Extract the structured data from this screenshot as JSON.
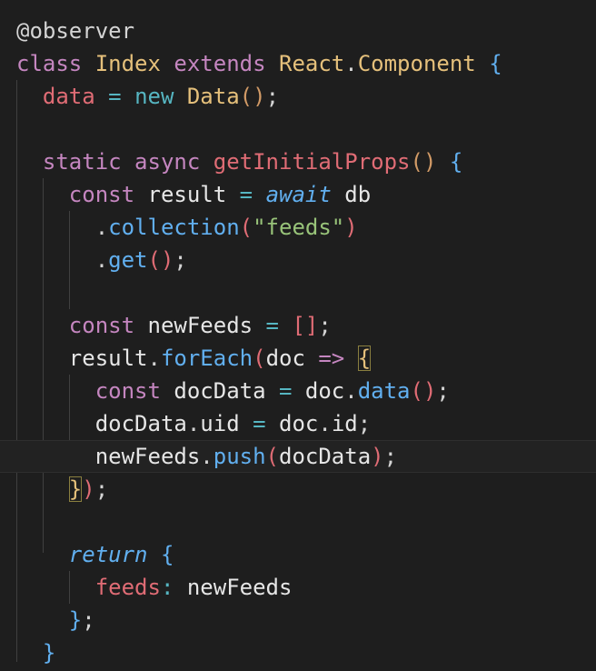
{
  "editor": {
    "lines": [
      {
        "tokens": [
          {
            "t": "@observer",
            "c": "tok-decorator"
          }
        ]
      },
      {
        "tokens": [
          {
            "t": "class ",
            "c": "tok-keyword"
          },
          {
            "t": "Index ",
            "c": "tok-class"
          },
          {
            "t": "extends ",
            "c": "tok-inherit"
          },
          {
            "t": "React",
            "c": "tok-class"
          },
          {
            "t": ".",
            "c": "tok-punct"
          },
          {
            "t": "Component ",
            "c": "tok-class"
          },
          {
            "t": "{",
            "c": "tok-brace"
          }
        ]
      },
      {
        "tokens": [
          {
            "t": "  data ",
            "c": "tok-prop"
          },
          {
            "t": "= ",
            "c": "tok-op"
          },
          {
            "t": "new ",
            "c": "tok-new"
          },
          {
            "t": "Data",
            "c": "tok-class"
          },
          {
            "t": "()",
            "c": "tok-paren"
          },
          {
            "t": ";",
            "c": "tok-punct"
          }
        ]
      },
      {
        "tokens": []
      },
      {
        "tokens": [
          {
            "t": "  static ",
            "c": "tok-keyword"
          },
          {
            "t": "async ",
            "c": "tok-keyword"
          },
          {
            "t": "getInitialProps",
            "c": "tok-prop"
          },
          {
            "t": "() ",
            "c": "tok-paren"
          },
          {
            "t": "{",
            "c": "tok-brace"
          }
        ]
      },
      {
        "tokens": [
          {
            "t": "    const ",
            "c": "tok-const"
          },
          {
            "t": "result ",
            "c": "tok-var"
          },
          {
            "t": "= ",
            "c": "tok-op"
          },
          {
            "t": "await ",
            "c": "tok-ital"
          },
          {
            "t": "db",
            "c": "tok-var"
          }
        ]
      },
      {
        "tokens": [
          {
            "t": "      .",
            "c": "tok-punct"
          },
          {
            "t": "collection",
            "c": "tok-func"
          },
          {
            "t": "(",
            "c": "tok-prop"
          },
          {
            "t": "\"feeds\"",
            "c": "tok-string"
          },
          {
            "t": ")",
            "c": "tok-prop"
          }
        ]
      },
      {
        "tokens": [
          {
            "t": "      .",
            "c": "tok-punct"
          },
          {
            "t": "get",
            "c": "tok-func"
          },
          {
            "t": "()",
            "c": "tok-prop"
          },
          {
            "t": ";",
            "c": "tok-punct"
          }
        ]
      },
      {
        "tokens": []
      },
      {
        "tokens": [
          {
            "t": "    const ",
            "c": "tok-const"
          },
          {
            "t": "newFeeds ",
            "c": "tok-var"
          },
          {
            "t": "= ",
            "c": "tok-op"
          },
          {
            "t": "[]",
            "c": "tok-prop"
          },
          {
            "t": ";",
            "c": "tok-punct"
          }
        ]
      },
      {
        "tokens": [
          {
            "t": "    result",
            "c": "tok-var"
          },
          {
            "t": ".",
            "c": "tok-punct"
          },
          {
            "t": "forEach",
            "c": "tok-func"
          },
          {
            "t": "(",
            "c": "tok-prop"
          },
          {
            "t": "doc ",
            "c": "tok-var"
          },
          {
            "t": "=> ",
            "c": "tok-const"
          },
          {
            "t": "{",
            "c": "tok-class",
            "box": true
          }
        ]
      },
      {
        "tokens": [
          {
            "t": "      const ",
            "c": "tok-const"
          },
          {
            "t": "docData ",
            "c": "tok-var"
          },
          {
            "t": "= ",
            "c": "tok-op"
          },
          {
            "t": "doc",
            "c": "tok-var"
          },
          {
            "t": ".",
            "c": "tok-punct"
          },
          {
            "t": "data",
            "c": "tok-func"
          },
          {
            "t": "()",
            "c": "tok-prop"
          },
          {
            "t": ";",
            "c": "tok-punct"
          }
        ]
      },
      {
        "tokens": [
          {
            "t": "      docData",
            "c": "tok-var"
          },
          {
            "t": ".",
            "c": "tok-punct"
          },
          {
            "t": "uid ",
            "c": "tok-var"
          },
          {
            "t": "= ",
            "c": "tok-op"
          },
          {
            "t": "doc",
            "c": "tok-var"
          },
          {
            "t": ".",
            "c": "tok-punct"
          },
          {
            "t": "id",
            "c": "tok-var"
          },
          {
            "t": ";",
            "c": "tok-punct"
          }
        ]
      },
      {
        "tokens": [
          {
            "t": "      newFeeds",
            "c": "tok-var"
          },
          {
            "t": ".",
            "c": "tok-punct"
          },
          {
            "t": "push",
            "c": "tok-func"
          },
          {
            "t": "(",
            "c": "tok-prop"
          },
          {
            "t": "docData",
            "c": "tok-var"
          },
          {
            "t": ")",
            "c": "tok-prop"
          },
          {
            "t": ";",
            "c": "tok-punct"
          }
        ],
        "current": true
      },
      {
        "tokens": [
          {
            "t": "    ",
            "c": "tok-punct"
          },
          {
            "t": "}",
            "c": "tok-class",
            "box": true
          },
          {
            "t": ")",
            "c": "tok-prop"
          },
          {
            "t": ";",
            "c": "tok-punct"
          }
        ]
      },
      {
        "tokens": []
      },
      {
        "tokens": [
          {
            "t": "    return ",
            "c": "tok-ital"
          },
          {
            "t": "{",
            "c": "tok-brace"
          }
        ]
      },
      {
        "tokens": [
          {
            "t": "      feeds",
            "c": "tok-prop"
          },
          {
            "t": ": ",
            "c": "tok-op"
          },
          {
            "t": "newFeeds",
            "c": "tok-var"
          }
        ]
      },
      {
        "tokens": [
          {
            "t": "    }",
            "c": "tok-brace"
          },
          {
            "t": ";",
            "c": "tok-punct"
          }
        ]
      },
      {
        "tokens": [
          {
            "t": "  }",
            "c": "tok-brace"
          }
        ]
      }
    ]
  }
}
